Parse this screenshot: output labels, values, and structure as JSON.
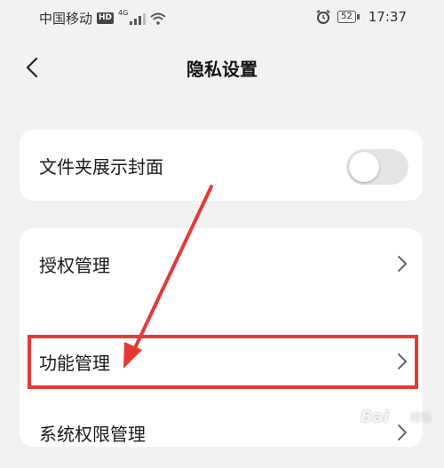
{
  "status_bar": {
    "carrier": "中国移动",
    "hd_badge": "HD",
    "network": "4G",
    "battery": "52",
    "time": "17:37"
  },
  "header": {
    "title": "隐私设置"
  },
  "settings": {
    "show_cover": {
      "label": "文件夹展示封面",
      "enabled": false
    },
    "authorization": {
      "label": "授权管理"
    },
    "features": {
      "label": "功能管理"
    },
    "system_permissions": {
      "label": "系统权限管理"
    }
  },
  "annotation": {
    "color": "#e53935"
  },
  "watermark": {
    "logo": "Bai",
    "sub": "经验"
  },
  "colors": {
    "background": "#f2f2f2",
    "card": "#ffffff",
    "toggle_off": "#e5e5e5"
  }
}
